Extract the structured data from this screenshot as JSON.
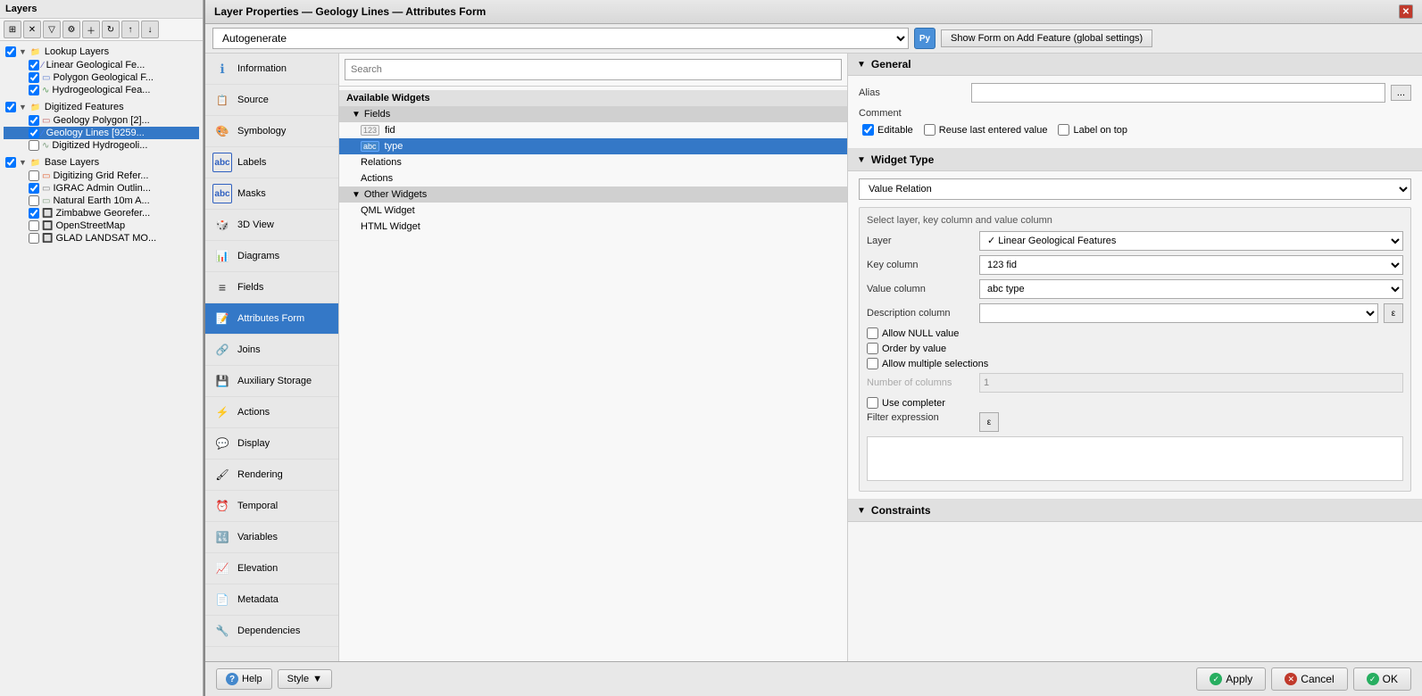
{
  "app": {
    "title": "Layer Properties — Geology Lines — Attributes Form"
  },
  "left_panel": {
    "title": "Layers",
    "groups": [
      {
        "name": "Lookup Layers",
        "expanded": true,
        "items": [
          {
            "label": "Linear Geological Fe...",
            "indent": 1,
            "checked": true,
            "type": "vector"
          },
          {
            "label": "Polygon Geological F...",
            "indent": 1,
            "checked": true,
            "type": "vector"
          },
          {
            "label": "Hydrogeological Fea...",
            "indent": 1,
            "checked": true,
            "type": "vector"
          }
        ]
      },
      {
        "name": "Digitized Features",
        "expanded": true,
        "items": [
          {
            "label": "Geology Polygon [2]...",
            "indent": 1,
            "checked": true,
            "type": "vector"
          },
          {
            "label": "Geology Lines [9259...",
            "indent": 1,
            "checked": true,
            "type": "vector",
            "selected": true
          },
          {
            "label": "Digitized Hydrogeoli...",
            "indent": 1,
            "checked": false,
            "type": "vector"
          }
        ]
      },
      {
        "name": "Base Layers",
        "expanded": true,
        "items": [
          {
            "label": "Digitizing Grid Refer...",
            "indent": 1,
            "checked": false,
            "type": "raster"
          },
          {
            "label": "IGRAC Admin Outlin...",
            "indent": 1,
            "checked": true,
            "type": "vector"
          },
          {
            "label": "Natural Earth 10m A...",
            "indent": 1,
            "checked": false,
            "type": "vector"
          },
          {
            "label": "Zimbabwe Georefer...",
            "indent": 1,
            "checked": true,
            "type": "raster"
          },
          {
            "label": "OpenStreetMap",
            "indent": 1,
            "checked": false,
            "type": "raster"
          },
          {
            "label": "GLAD LANDSAT MO...",
            "indent": 1,
            "checked": false,
            "type": "raster"
          }
        ]
      }
    ]
  },
  "dialog": {
    "title": "Layer Properties — Geology Lines — Attributes Form",
    "toolbar": {
      "autogenerate_label": "Autogenerate",
      "show_form_label": "Show Form on Add Feature (global settings)",
      "python_icon": "Py"
    },
    "nav": [
      {
        "id": "information",
        "label": "Information",
        "icon": "ℹ"
      },
      {
        "id": "source",
        "label": "Source",
        "icon": "📋"
      },
      {
        "id": "symbology",
        "label": "Symbology",
        "icon": "🎨"
      },
      {
        "id": "labels",
        "label": "Labels",
        "icon": "abc"
      },
      {
        "id": "masks",
        "label": "Masks",
        "icon": "abc"
      },
      {
        "id": "3dview",
        "label": "3D View",
        "icon": "🎲"
      },
      {
        "id": "diagrams",
        "label": "Diagrams",
        "icon": "📊"
      },
      {
        "id": "fields",
        "label": "Fields",
        "icon": "≡"
      },
      {
        "id": "attributes_form",
        "label": "Attributes Form",
        "icon": "📝",
        "active": true
      },
      {
        "id": "joins",
        "label": "Joins",
        "icon": "🔗"
      },
      {
        "id": "auxiliary_storage",
        "label": "Auxiliary Storage",
        "icon": "💾"
      },
      {
        "id": "actions",
        "label": "Actions",
        "icon": "⚡"
      },
      {
        "id": "display",
        "label": "Display",
        "icon": "💬"
      },
      {
        "id": "rendering",
        "label": "Rendering",
        "icon": "🖌"
      },
      {
        "id": "temporal",
        "label": "Temporal",
        "icon": "⏰"
      },
      {
        "id": "variables",
        "label": "Variables",
        "icon": "🔣"
      },
      {
        "id": "elevation",
        "label": "Elevation",
        "icon": "📈"
      },
      {
        "id": "metadata",
        "label": "Metadata",
        "icon": "📄"
      },
      {
        "id": "dependencies",
        "label": "Dependencies",
        "icon": "🔧"
      }
    ],
    "widget_panel": {
      "search_placeholder": "Search",
      "available_widgets_label": "Available Widgets",
      "fields_header": "Fields",
      "fields": [
        {
          "id": "fid",
          "type": "123",
          "label": "fid"
        },
        {
          "id": "type",
          "type": "abc",
          "label": "type",
          "selected": true
        }
      ],
      "relations_label": "Relations",
      "actions_label": "Actions",
      "other_widgets_header": "Other Widgets",
      "other_widgets": [
        {
          "label": "QML Widget"
        },
        {
          "label": "HTML Widget"
        }
      ]
    },
    "properties": {
      "general": {
        "header": "General",
        "alias_label": "Alias",
        "alias_value": "",
        "comment_label": "Comment",
        "editable_label": "Editable",
        "editable_checked": true,
        "reuse_last_label": "Reuse last entered value",
        "reuse_last_checked": false,
        "label_on_top_label": "Label on top",
        "label_on_top_checked": false,
        "dots_btn_label": "..."
      },
      "widget_type": {
        "header": "Widget Type",
        "selected_type": "Value Relation",
        "config_label": "Select layer, key column and value column",
        "layer_label": "Layer",
        "layer_value": "✓ Linear Geological Features",
        "key_column_label": "Key column",
        "key_column_value": "123 fid",
        "value_column_label": "Value column",
        "value_column_value": "abc type",
        "description_column_label": "Description column",
        "description_column_value": "",
        "allow_null_label": "Allow NULL value",
        "allow_null_checked": false,
        "order_by_label": "Order by value",
        "order_by_checked": false,
        "allow_multiple_label": "Allow multiple selections",
        "allow_multiple_checked": false,
        "num_columns_label": "Number of columns",
        "num_columns_value": "1",
        "use_completer_label": "Use completer",
        "use_completer_checked": false,
        "filter_expr_label": "Filter expression",
        "filter_expr_value": ""
      },
      "constraints": {
        "header": "Constraints"
      }
    },
    "footer": {
      "help_label": "Help",
      "style_label": "Style",
      "style_arrow": "▼",
      "apply_label": "Apply",
      "cancel_label": "Cancel",
      "ok_label": "OK"
    }
  }
}
